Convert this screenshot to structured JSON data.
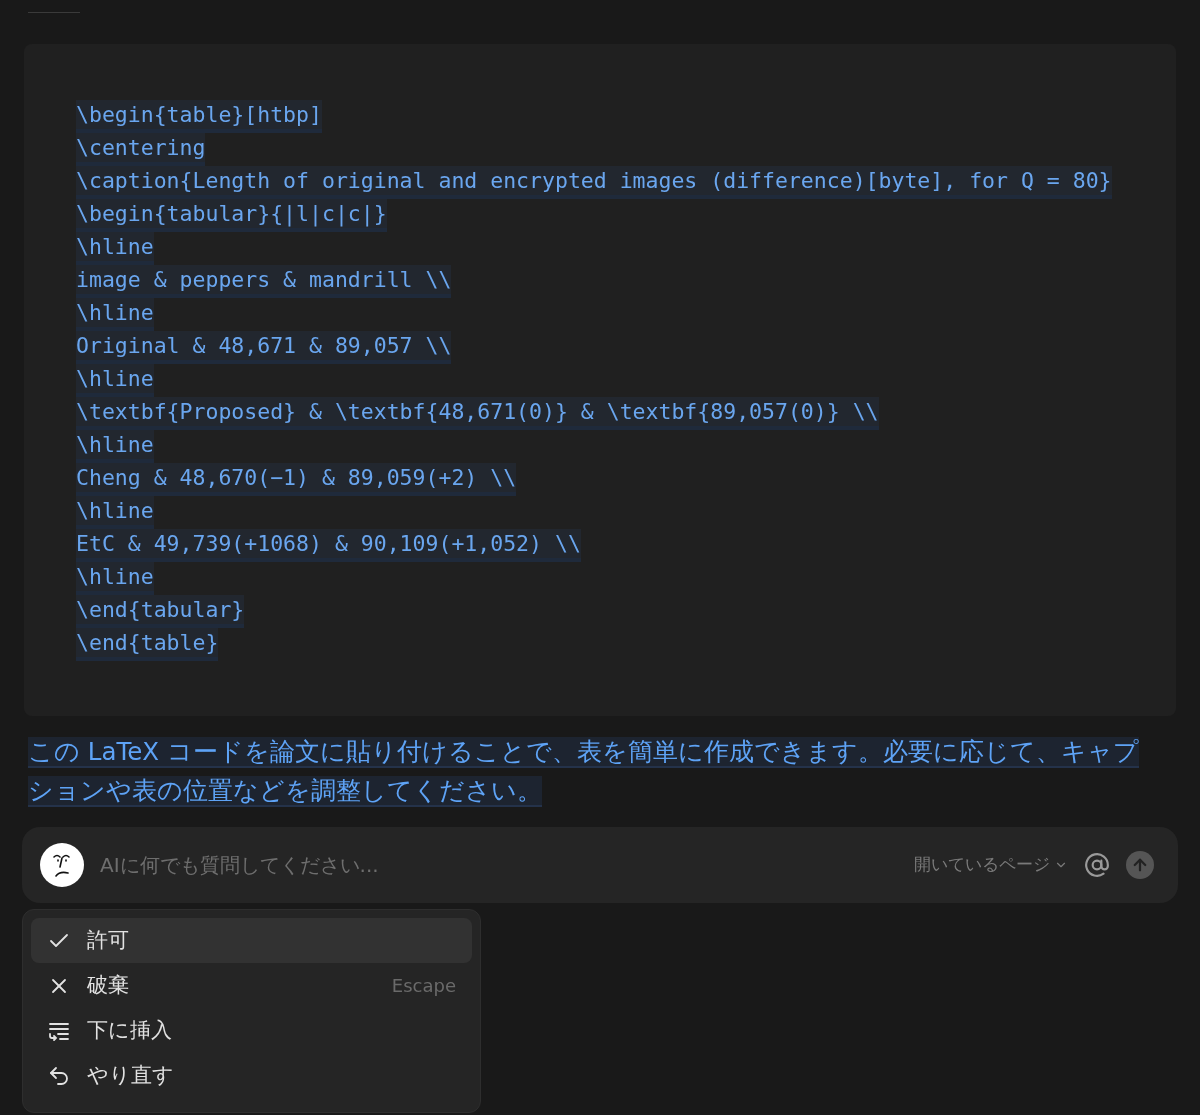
{
  "code_block": {
    "lines": [
      "\\begin{table}[htbp]",
      "\\centering",
      "\\caption{Length of original and encrypted images (difference)[byte], for Q = 80}",
      "\\begin{tabular}{|l|c|c|}",
      "\\hline",
      "image & peppers & mandrill \\\\",
      "\\hline",
      "Original & 48,671 & 89,057 \\\\",
      "\\hline",
      "\\textbf{Proposed} & \\textbf{48,671(0)} & \\textbf{89,057(0)} \\\\",
      "\\hline",
      "Cheng & 48,670(−1) & 89,059(+2) \\\\",
      "\\hline",
      "EtC & 49,739(+1068) & 90,109(+1,052) \\\\",
      "\\hline",
      "\\end{tabular}",
      "\\end{table}"
    ]
  },
  "message": "この LaTeX コードを論文に貼り付けることで、表を簡単に作成できます。必要に応じて、キャプションや表の位置などを調整してください。",
  "prompt_bar": {
    "placeholder": "AIに何でも質問してください...",
    "context_selector": "開いているページ"
  },
  "menu": {
    "items": [
      {
        "label": "許可",
        "selected": true
      },
      {
        "label": "破棄",
        "selected": false,
        "shortcut": "Escape"
      },
      {
        "label": "下に挿入",
        "selected": false
      },
      {
        "label": "やり直す",
        "selected": false
      }
    ]
  }
}
